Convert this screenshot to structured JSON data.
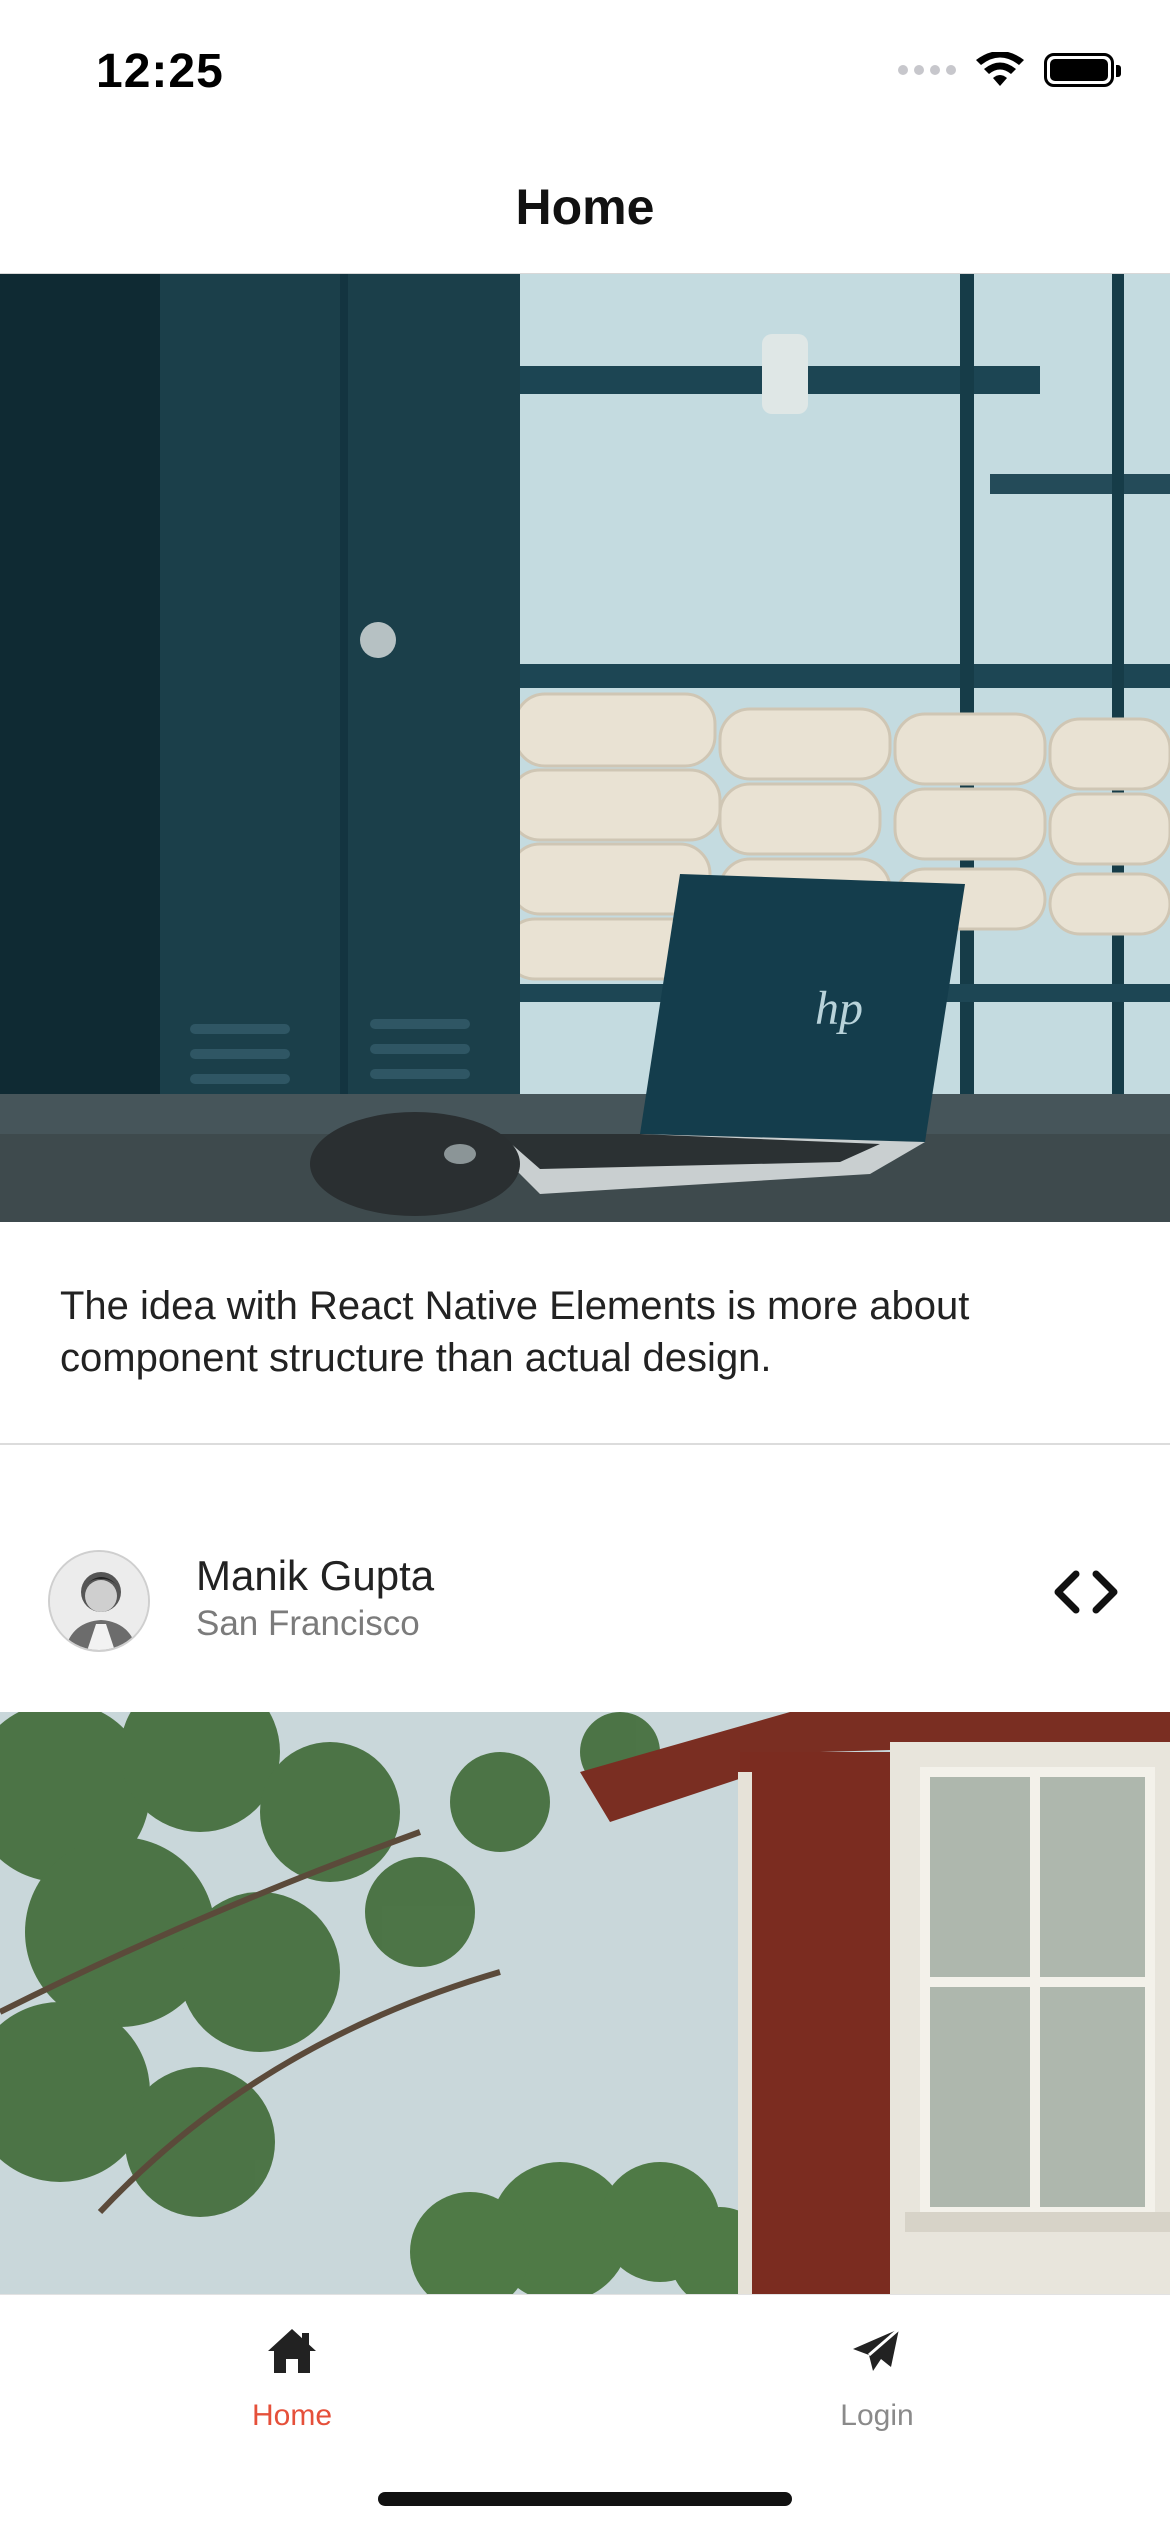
{
  "status_bar": {
    "time": "12:25"
  },
  "header": {
    "title": "Home"
  },
  "card1": {
    "image_icon": "laptop-desk-photo",
    "text": "The idea with React Native Elements is more about component structure than actual design."
  },
  "card2": {
    "user_name": "Manik Gupta",
    "user_location": "San Francisco",
    "action_icon": "code-icon",
    "image_icon": "tree-house-photo"
  },
  "tab_bar": {
    "tabs": [
      {
        "label": "Home",
        "icon": "home-icon",
        "active": true
      },
      {
        "label": "Login",
        "icon": "paper-plane-icon",
        "active": false
      }
    ]
  },
  "colors": {
    "active_tab": "#e5503a",
    "inactive_tab": "#8a8a8a"
  }
}
